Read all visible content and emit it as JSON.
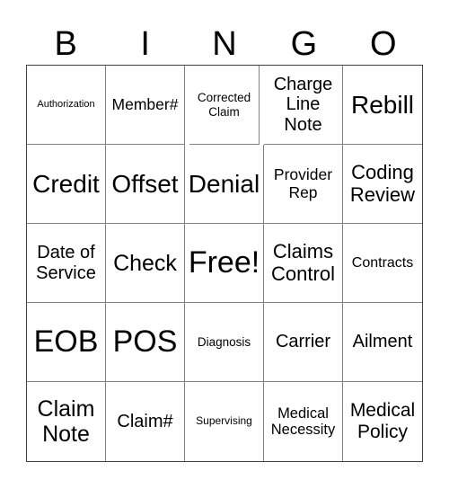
{
  "header": {
    "letters": [
      "B",
      "I",
      "N",
      "G",
      "O"
    ]
  },
  "cells": [
    [
      "Authorization",
      "Member#",
      "Corrected Claim",
      "Charge Line Note",
      "Rebill"
    ],
    [
      "Credit",
      "Offset",
      "Denial",
      "Provider Rep",
      "Coding Review"
    ],
    [
      "Date of Service",
      "Check",
      "Free!",
      "Claims Control",
      "Contracts"
    ],
    [
      "EOB",
      "POS",
      "Diagnosis",
      "Carrier",
      "Ailment"
    ],
    [
      "Claim Note",
      "Claim#",
      "Supervising",
      "Medical Necessity",
      "Medical Policy"
    ]
  ]
}
